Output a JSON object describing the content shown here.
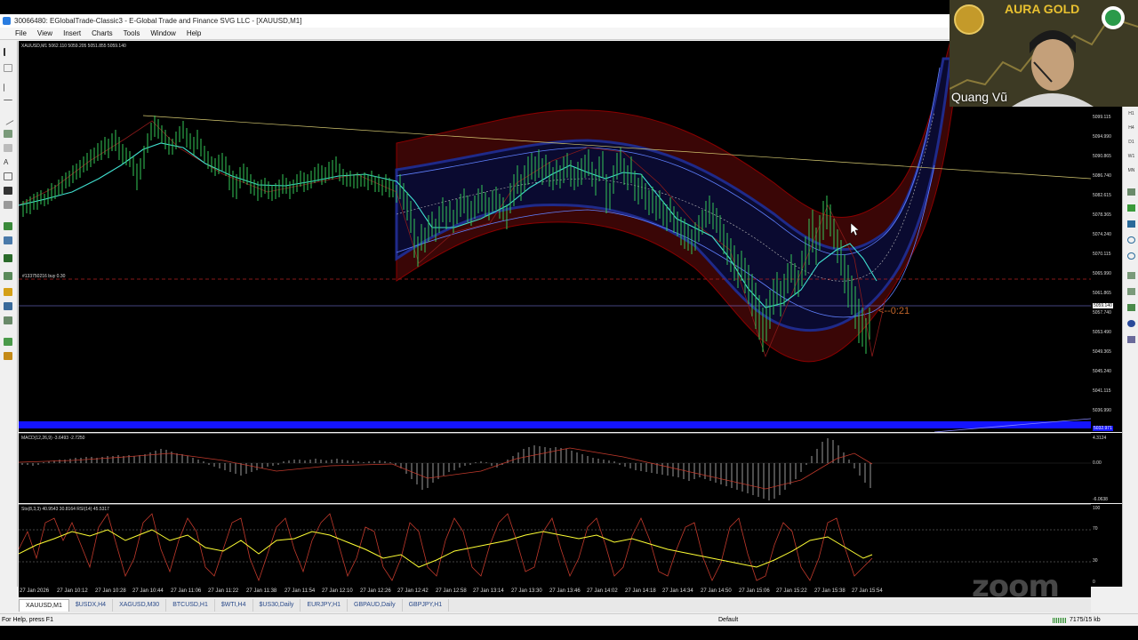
{
  "window": {
    "title": "30066480: EGlobalTrade-Classic3 - E-Global Trade and Finance SVG LLC - [XAUUSD,M1]"
  },
  "menu": [
    "File",
    "View",
    "Insert",
    "Charts",
    "Tools",
    "Window",
    "Help"
  ],
  "chart": {
    "header": "XAUUSD,M1  5062.110 5059.205 5051.855 5059.140",
    "order_label": "#133750216 buy 0.30",
    "countdown": "<--0:21",
    "price_axis": [
      "5099.115",
      "5094.990",
      "5090.865",
      "5086.740",
      "5082.615",
      "5078.365",
      "5074.240",
      "5070.115",
      "5065.990",
      "5061.865",
      "5057.740",
      "5053.490",
      "5049.365",
      "5045.240",
      "5041.115",
      "5036.990"
    ],
    "bid_price": "5059.140",
    "blue_price": "5032.971",
    "colors": {
      "candles": "#34c759",
      "ma": "#40e0d0",
      "envelope": "#8b0000",
      "inner_band": "#1a237e",
      "hline": "#8888ff",
      "dashed": "#b22222"
    }
  },
  "macd": {
    "header": "MACD(12,26,9) -3.6493 -2.7250",
    "axis": [
      "4.3124",
      "0.00",
      "-6.0638"
    ]
  },
  "stoch": {
    "header": "Sto(8,3,3) 40.9543 30.8164  RSI(14) 45.5317",
    "axis": [
      "100",
      "70",
      "30",
      "0"
    ]
  },
  "time_axis": [
    "27 Jan 2026",
    "27 Jan 10:12",
    "27 Jan 10:28",
    "27 Jan 10:44",
    "27 Jan 11:06",
    "27 Jan 11:22",
    "27 Jan 11:38",
    "27 Jan 11:54",
    "27 Jan 12:10",
    "27 Jan 12:26",
    "27 Jan 12:42",
    "27 Jan 12:58",
    "27 Jan 13:14",
    "27 Jan 13:30",
    "27 Jan 13:46",
    "27 Jan 14:02",
    "27 Jan 14:18",
    "27 Jan 14:34",
    "27 Jan 14:50",
    "27 Jan 15:06",
    "27 Jan 15:22",
    "27 Jan 15:38",
    "27 Jan 15:54"
  ],
  "tabs": [
    "XAUUSD,M1",
    "$USDX,H4",
    "XAGUSD,M30",
    "BTCUSD,H1",
    "$WTI,H4",
    "$US30,Daily",
    "EURJPY,H1",
    "GBPAUD,Daily",
    "GBPJPY,H1"
  ],
  "status": {
    "help": "For Help, press F1",
    "profile": "Default",
    "traffic": "7175/15 kb"
  },
  "webcam": {
    "brand": "AURA GOLD",
    "presenter": "Quang Vũ"
  },
  "watermark": "zoom"
}
